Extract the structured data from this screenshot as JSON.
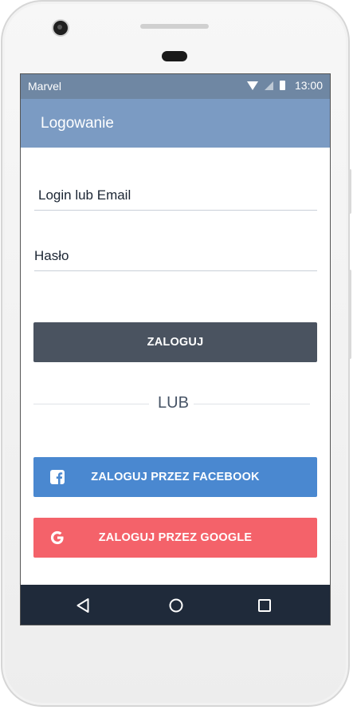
{
  "statusbar": {
    "carrier": "Marvel",
    "time": "13:00"
  },
  "appbar": {
    "title": "Logowanie"
  },
  "form": {
    "login_value": "Login lub Email",
    "password_value": "Hasło",
    "login_button": "ZALOGUJ",
    "divider_text": "LUB",
    "facebook_button": "ZALOGUJ PRZEZ FACEBOOK",
    "google_button": "ZALOGUJ PRZEZ GOOGLE"
  },
  "icons": {
    "statusbar": [
      "wifi-icon",
      "signal-icon",
      "battery-icon"
    ],
    "facebook": "facebook-icon",
    "google": "google-icon",
    "navigation": [
      "back-icon",
      "home-icon",
      "recents-icon"
    ]
  },
  "colors": {
    "statusbar": "#6f87a3",
    "appbar": "#7b9bc3",
    "login_button": "#4a5360",
    "facebook_button": "#4a88d0",
    "google_button": "#f4626a",
    "navbar": "#1f2a3a"
  }
}
